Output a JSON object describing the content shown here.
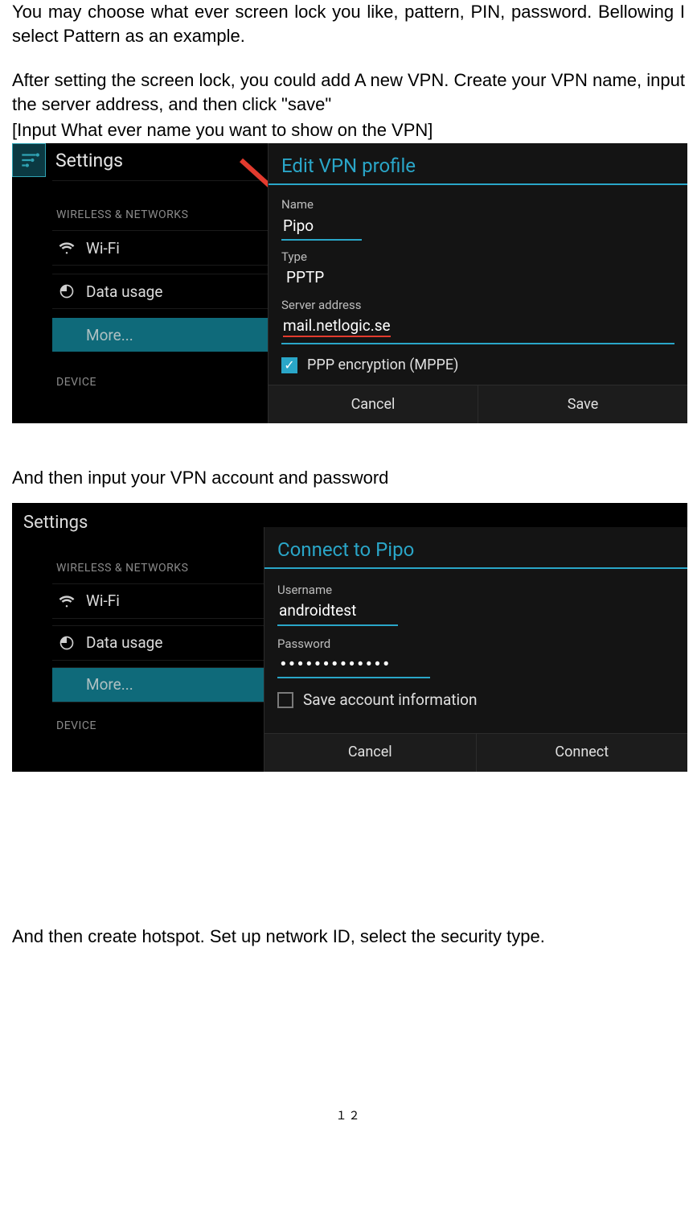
{
  "doc": {
    "p1": "You may choose what ever screen lock you like, pattern, PIN, password. Bellowing I select Pattern as an example.",
    "p2": "After setting the screen lock, you could add A new VPN. Create your VPN name, input the server address, and then click \"save\"",
    "p3": "[Input What ever name you want to show on the VPN]",
    "p4": "And then input your VPN account and password",
    "p5": "And then create hotspot. Set up network ID, select the security type.",
    "page_num": "１２"
  },
  "shot1": {
    "settings_title": "Settings",
    "section_wireless": "WIRELESS & NETWORKS",
    "section_device": "DEVICE",
    "wifi": "Wi-Fi",
    "data_usage": "Data usage",
    "more": "More...",
    "dialog_title": "Edit VPN profile",
    "name_label": "Name",
    "name_value": "Pipo",
    "type_label": "Type",
    "type_value": "PPTP",
    "server_label": "Server address",
    "server_value": "mail.netlogic.se",
    "ppp_label": "PPP encryption (MPPE)",
    "cancel": "Cancel",
    "save": "Save"
  },
  "shot2": {
    "settings_title": "Settings",
    "section_wireless": "WIRELESS & NETWORKS",
    "section_device": "DEVICE",
    "wifi": "Wi-Fi",
    "data_usage": "Data usage",
    "more": "More...",
    "dialog_title": "Connect to Pipo",
    "user_label": "Username",
    "user_value": "androidtest",
    "pass_label": "Password",
    "pass_value": "•••••••••••••",
    "save_acct": "Save account information",
    "cancel": "Cancel",
    "connect": "Connect"
  }
}
